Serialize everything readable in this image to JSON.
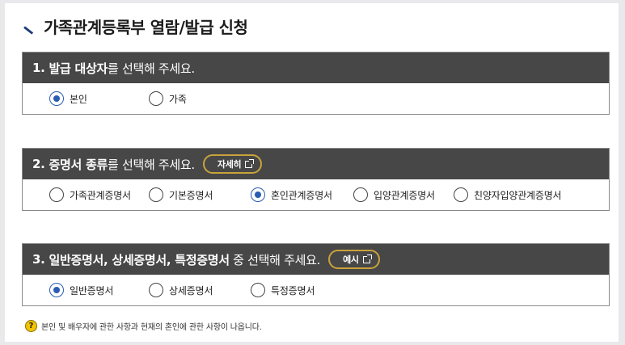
{
  "page": {
    "title": "가족관계등록부 열람/발급 신청"
  },
  "sections": [
    {
      "num": "1.",
      "heading_strong": "발급 대상자",
      "heading_rest": "를 선택해 주세요.",
      "options": [
        {
          "label": "본인",
          "selected": true
        },
        {
          "label": "가족",
          "selected": false
        }
      ]
    },
    {
      "num": "2.",
      "heading_strong": "증명서 종류",
      "heading_rest": "를 선택해 주세요.",
      "button_label": "자세히",
      "options": [
        {
          "label": "가족관계증명서",
          "selected": false
        },
        {
          "label": "기본증명서",
          "selected": false
        },
        {
          "label": "혼인관계증명서",
          "selected": true
        },
        {
          "label": "입양관계증명서",
          "selected": false
        },
        {
          "label": "친양자입양관계증명서",
          "selected": false
        }
      ]
    },
    {
      "num": "3.",
      "heading_strong": "일반증명서, 상세증명서, 특정증명서",
      "heading_rest": " 중 선택해 주세요.",
      "button_label": "예시",
      "options": [
        {
          "label": "일반증명서",
          "selected": true
        },
        {
          "label": "상세증명서",
          "selected": false
        },
        {
          "label": "특정증명서",
          "selected": false
        }
      ]
    }
  ],
  "note": {
    "icon": "question-icon",
    "icon_glyph": "?",
    "text": "본인 및 배우자에 관한 사항과 현재의 혼인에 관한 사항이 나옵니다."
  },
  "colors": {
    "header_bg": "#474747",
    "accent": "#2a5db0",
    "pill_border": "#c9a23a",
    "note_icon": "#f2c400"
  }
}
